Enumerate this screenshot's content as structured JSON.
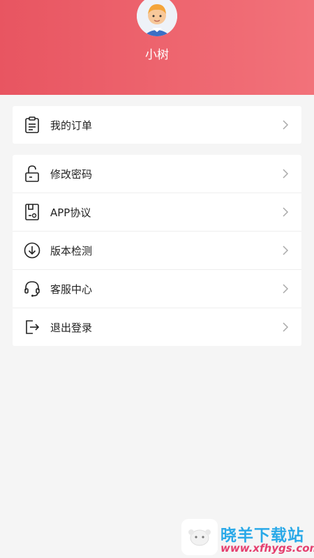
{
  "profile": {
    "name": "小树"
  },
  "menu_group_1": [
    {
      "label": "我的订单",
      "icon": "clipboard-icon"
    }
  ],
  "menu_group_2": [
    {
      "label": "修改密码",
      "icon": "lock-icon"
    },
    {
      "label": "APP协议",
      "icon": "document-icon"
    },
    {
      "label": "版本检测",
      "icon": "download-circle-icon"
    },
    {
      "label": "客服中心",
      "icon": "headset-icon"
    },
    {
      "label": "退出登录",
      "icon": "logout-icon"
    }
  ],
  "watermark": {
    "title": "晓羊下载站",
    "url": "www.xfhygs.com"
  },
  "colors": {
    "header_start": "#e85561",
    "header_end": "#f2727a",
    "background": "#f5f5f5",
    "watermark_title": "#2aa9e8",
    "watermark_url": "#e53f6f"
  }
}
